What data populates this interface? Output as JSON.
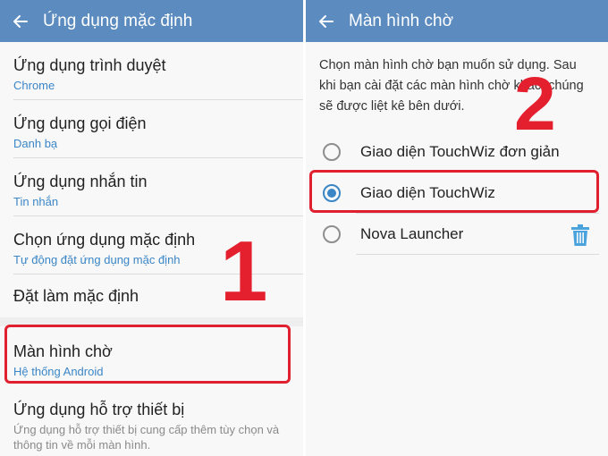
{
  "left": {
    "title": "Ứng dụng mặc định",
    "items": [
      {
        "title": "Ứng dụng trình duyệt",
        "subtitle": "Chrome"
      },
      {
        "title": "Ứng dụng gọi điện",
        "subtitle": "Danh bạ"
      },
      {
        "title": "Ứng dụng nhắn tin",
        "subtitle": "Tin nhắn"
      },
      {
        "title": "Chọn ứng dụng mặc định",
        "subtitle": "Tự động đặt ứng dụng mặc định"
      },
      {
        "title": "Đặt làm mặc định"
      },
      {
        "title": "Màn hình chờ",
        "subtitle": "Hệ thống Android"
      },
      {
        "title": "Ứng dụng hỗ trợ thiết bị",
        "description": "Ứng dụng hỗ trợ thiết bị cung cấp thêm tùy chọn và thông tin về mỗi màn hình."
      }
    ],
    "step_number": "1"
  },
  "right": {
    "title": "Màn hình chờ",
    "description": "Chọn màn hình chờ bạn muốn sử dụng. Sau khi bạn cài đặt các màn hình chờ khác, chúng sẽ được liệt kê bên dưới.",
    "options": [
      {
        "label": "Giao diện TouchWiz đơn giản",
        "selected": false
      },
      {
        "label": "Giao diện TouchWiz",
        "selected": true
      },
      {
        "label": "Nova Launcher",
        "selected": false
      }
    ],
    "step_number": "2"
  },
  "colors": {
    "appbar": "#5b8bbf",
    "accent": "#3b86c6",
    "highlight": "#e0202f"
  },
  "icons": {
    "back": "arrow-left-icon",
    "delete": "trash-icon"
  }
}
